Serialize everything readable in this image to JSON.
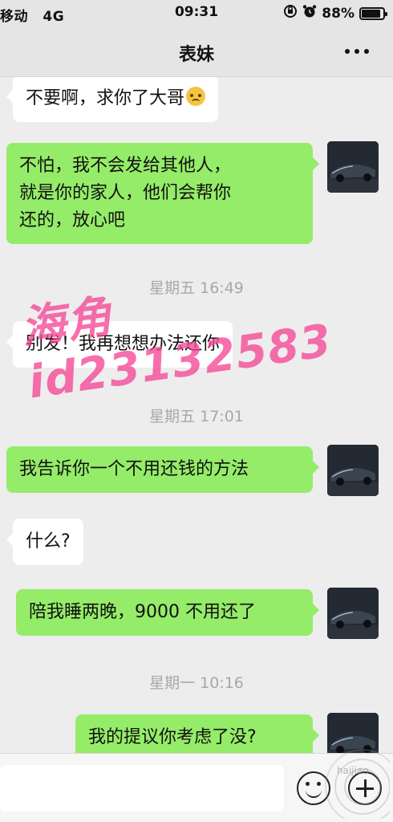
{
  "status_bar": {
    "carrier": "移动",
    "network": "4G",
    "time": "09:31",
    "battery_percent": "88%",
    "battery_level": 0.88,
    "icons": [
      "rotation-lock-icon",
      "alarm-icon",
      "battery-icon"
    ]
  },
  "nav": {
    "title": "表妹",
    "more_icon": "more-dots-icon"
  },
  "messages": [
    {
      "side": "in",
      "lines": [
        "不要啊，求你了大哥"
      ],
      "emoji": "crying-emoji-icon"
    },
    {
      "side": "out",
      "lines": [
        "不怕，我不会发给其他人，",
        "就是你的家人，他们会帮你",
        "还的，放心吧"
      ]
    },
    {
      "type": "time",
      "text": "星期五 16:49"
    },
    {
      "side": "in",
      "lines": [
        "别发！我再想想办法还你"
      ]
    },
    {
      "type": "time",
      "text": "星期五 17:01"
    },
    {
      "side": "out",
      "lines": [
        "我告诉你一个不用还钱的方法"
      ]
    },
    {
      "side": "in",
      "lines": [
        "什么?"
      ]
    },
    {
      "side": "out",
      "lines": [
        "陪我睡两晚，9000 不用还了"
      ]
    },
    {
      "type": "time",
      "text": "星期一 10:16"
    },
    {
      "side": "out",
      "lines": [
        "我的提议你考虑了没?"
      ]
    }
  ],
  "watermark": "海角id23132583",
  "corner_logo_text": "haijiao",
  "input_bar": {
    "placeholder": "",
    "emoji_icon": "emoji-face-icon",
    "plus_icon": "plus-circle-icon"
  },
  "colors": {
    "outgoing_bubble": "#95ec69",
    "incoming_bubble": "#ffffff",
    "background": "#ededed",
    "watermark": "#f54696"
  }
}
